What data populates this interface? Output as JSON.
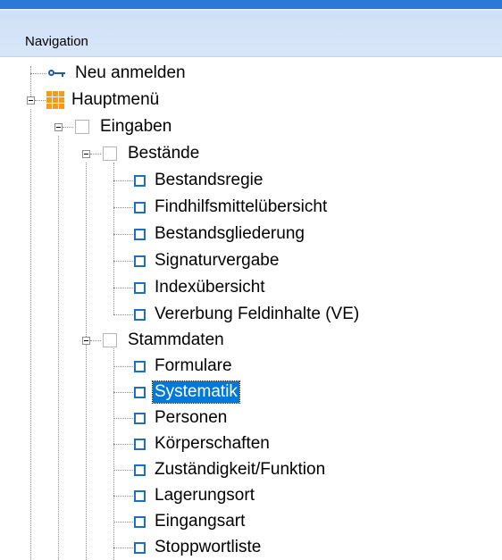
{
  "panel": {
    "title": "Navigation"
  },
  "tree": {
    "login": "Neu anmelden",
    "main_menu": "Hauptmenü",
    "eingaben": "Eingaben",
    "bestaende": {
      "label": "Bestände",
      "children": [
        "Bestandsregie",
        "Findhilfsmittelübersicht",
        "Bestandsgliederung",
        "Signaturvergabe",
        "Indexübersicht",
        "Vererbung Feldinhalte (VE)"
      ]
    },
    "stammdaten": {
      "label": "Stammdaten",
      "children": [
        "Formulare",
        "Systematik",
        "Personen",
        "Körperschaften",
        "Zuständigkeit/Funktion",
        "Lagerungsort",
        "Eingangsart",
        "Stoppwortliste"
      ]
    },
    "selected": "Systematik"
  },
  "colors": {
    "accent": "#0078d7",
    "header_bg": "#d8e6f8",
    "icon_blue": "#1e6fc0",
    "menu_icon": "#f59a1b"
  }
}
